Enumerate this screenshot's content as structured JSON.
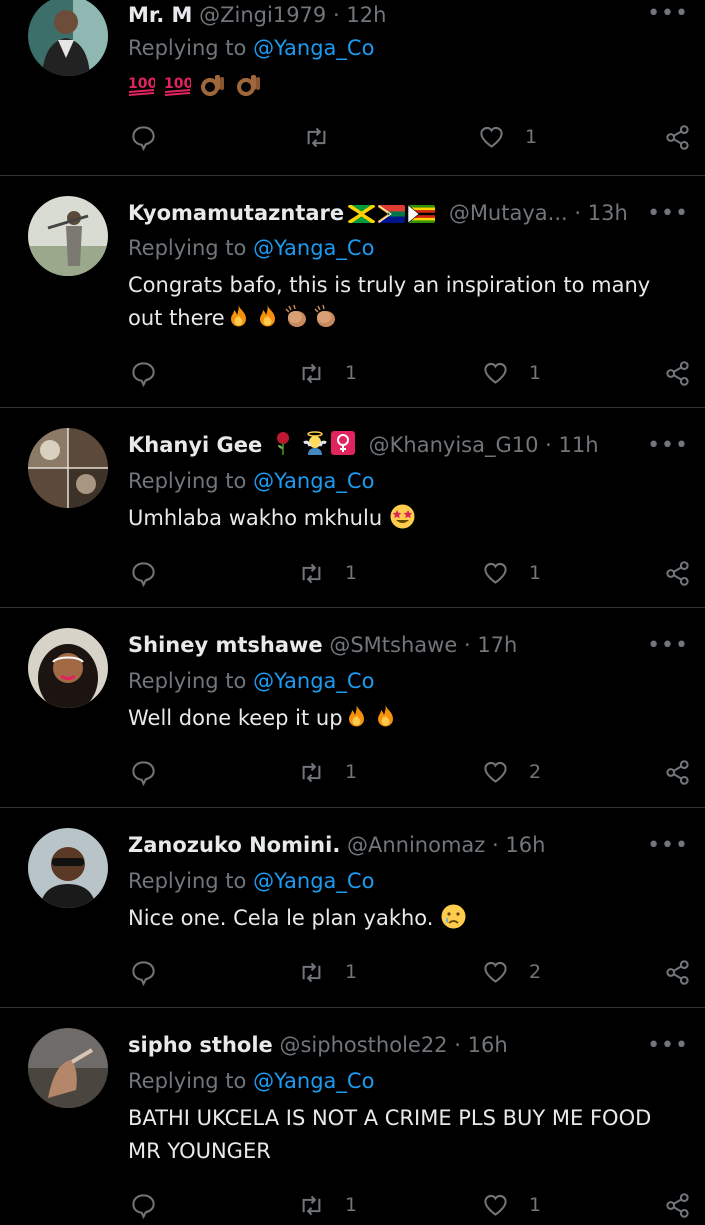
{
  "tweets": [
    {
      "name": "Mr. M",
      "handle": "@Zingi1979",
      "dot": "·",
      "time": "12h",
      "replying_prefix": "Replying to",
      "replying_to": "@Yanga_Co",
      "text": "",
      "emojis": [
        "hundred-points",
        "hundred-points",
        "ok-hand",
        "ok-hand"
      ],
      "retweets": "",
      "likes": "1"
    },
    {
      "name": "Kyomamutazntare",
      "name_flags": [
        "jamaica-flag",
        "south-africa-flag",
        "zimbabwe-flag"
      ],
      "handle": "@Mutaya...",
      "dot": "·",
      "time": "13h",
      "replying_prefix": "Replying to",
      "replying_to": "@Yanga_Co",
      "text": "Congrats bafo, this is truly an inspiration to many out there",
      "emojis": [
        "fire",
        "fire",
        "clapping-hands",
        "clapping-hands"
      ],
      "retweets": "1",
      "likes": "1"
    },
    {
      "name": "Khanyi Gee",
      "name_emojis": [
        "rose",
        "angel",
        "female-sign"
      ],
      "handle": "@Khanyisa_G10",
      "dot": "·",
      "time": "11h",
      "replying_prefix": "Replying to",
      "replying_to": "@Yanga_Co",
      "text": "Umhlaba wakho mkhulu",
      "emojis": [
        "star-struck"
      ],
      "retweets": "1",
      "likes": "1"
    },
    {
      "name": "Shiney mtshawe",
      "handle": "@SMtshawe",
      "dot": "·",
      "time": "17h",
      "replying_prefix": "Replying to",
      "replying_to": "@Yanga_Co",
      "text": "Well done keep it up",
      "emojis": [
        "fire",
        "fire"
      ],
      "retweets": "1",
      "likes": "2"
    },
    {
      "name": "Zanozuko Nomini.",
      "handle": "@Anninomaz",
      "dot": "·",
      "time": "16h",
      "replying_prefix": "Replying to",
      "replying_to": "@Yanga_Co",
      "text": "Nice one. Cela le plan yakho.",
      "emojis": [
        "crying-face"
      ],
      "retweets": "1",
      "likes": "2"
    },
    {
      "name": "sipho sthole",
      "handle": "@siphosthole22",
      "dot": "·",
      "time": "16h",
      "replying_prefix": "Replying to",
      "replying_to": "@Yanga_Co",
      "text": "BATHI UKCELA IS NOT A CRIME PLS BUY ME FOOD MR YOUNGER",
      "emojis": [],
      "retweets": "1",
      "likes": "1"
    }
  ],
  "colors": {
    "background": "#000000",
    "divider": "#2f3336",
    "muted": "#71767b",
    "link": "#1d9bf0",
    "text": "#e7e9ea"
  },
  "icons": {
    "reply": "reply-icon",
    "retweet": "retweet-icon",
    "like": "heart-icon",
    "share": "share-icon",
    "more": "more-icon"
  }
}
